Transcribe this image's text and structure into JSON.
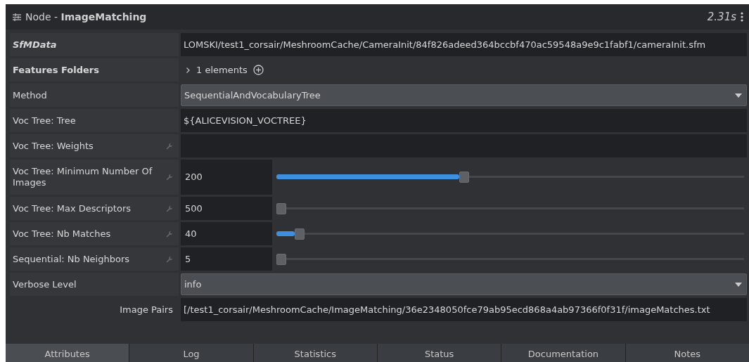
{
  "header": {
    "prefix": "Node - ",
    "node_name": "ImageMatching",
    "time": "2.31s"
  },
  "attributes": [
    {
      "label": "SfMData",
      "bold": true,
      "italic": true,
      "wrench": false,
      "kind": "text",
      "value": "LOMSKI/test1_corsair/MeshroomCache/CameraInit/84f826adeed364bccbf470ac59548a9e9c1fabf1/cameraInit.sfm"
    },
    {
      "label": "Features Folders",
      "bold": true,
      "italic": false,
      "wrench": false,
      "kind": "list",
      "value": "1 elements",
      "expanded": false
    },
    {
      "label": "Method",
      "bold": false,
      "italic": false,
      "wrench": false,
      "kind": "combo",
      "value": "SequentialAndVocabularyTree"
    },
    {
      "label": "Voc Tree: Tree",
      "bold": false,
      "italic": false,
      "wrench": false,
      "kind": "text",
      "value": "${ALICEVISION_VOCTREE}"
    },
    {
      "label": "Voc Tree: Weights",
      "bold": false,
      "italic": false,
      "wrench": true,
      "kind": "text"
    },
    {
      "label": "Voc Tree: Minimum Number Of Images",
      "bold": false,
      "italic": false,
      "wrench": true,
      "kind": "slider",
      "value": "200",
      "level": 0.4
    },
    {
      "label": "Voc Tree: Max Descriptors",
      "bold": false,
      "italic": false,
      "wrench": true,
      "kind": "slider",
      "value": "500",
      "level": 0.0
    },
    {
      "label": "Voc Tree: Nb Matches",
      "bold": false,
      "italic": false,
      "wrench": true,
      "kind": "slider",
      "value": "40",
      "level": 0.04
    },
    {
      "label": "Sequential: Nb Neighbors",
      "bold": false,
      "italic": false,
      "wrench": true,
      "kind": "slider",
      "value": "5",
      "level": 0.0
    },
    {
      "label": "Verbose Level",
      "bold": false,
      "italic": false,
      "wrench": false,
      "kind": "combo",
      "value": "info"
    },
    {
      "label": "Image Pairs",
      "bold": false,
      "italic": false,
      "wrench": false,
      "kind": "output",
      "value": "[/test1_corsair/MeshroomCache/ImageMatching/36e2348050fce79ab95ecd868a4ab97366f0f31f/imageMatches.txt"
    }
  ],
  "tabs": [
    {
      "label": "Attributes",
      "selected": true
    },
    {
      "label": "Log",
      "selected": false
    },
    {
      "label": "Statistics",
      "selected": false
    },
    {
      "label": "Status",
      "selected": false
    },
    {
      "label": "Documentation",
      "selected": false
    },
    {
      "label": "Notes",
      "selected": false
    }
  ]
}
